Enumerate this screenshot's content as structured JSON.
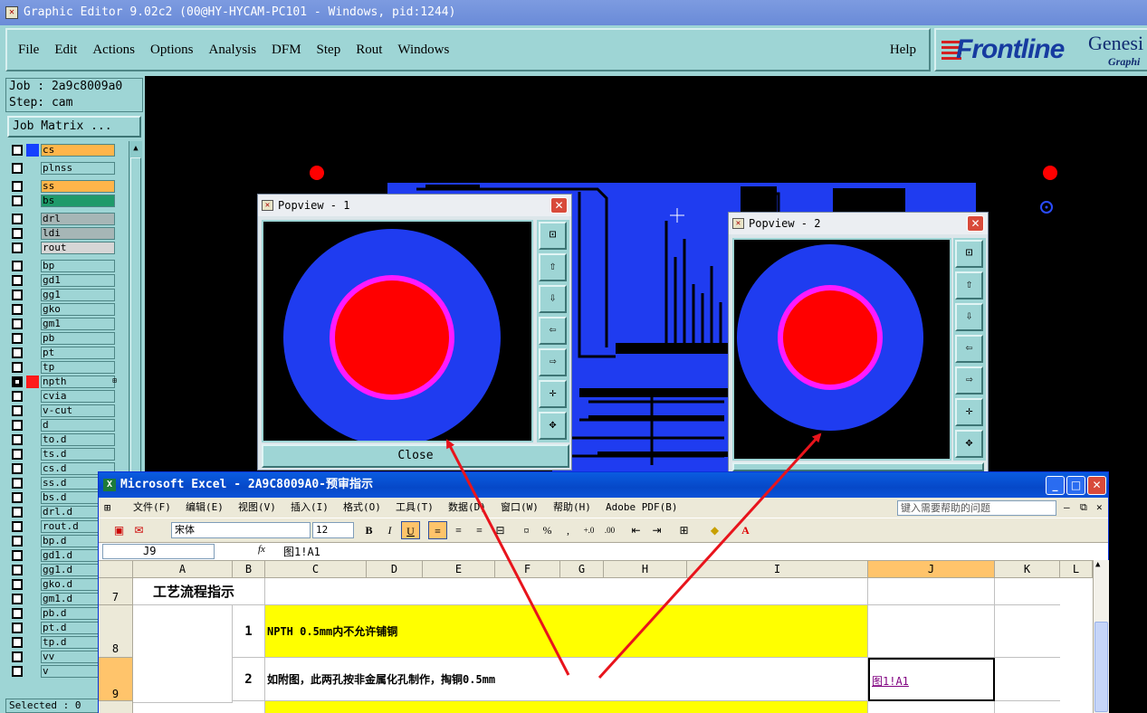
{
  "titlebar": {
    "title": "Graphic Editor 9.02c2 (00@HY-HYCAM-PC101 - Windows, pid:1244)"
  },
  "menu": {
    "items": [
      "File",
      "Edit",
      "Actions",
      "Options",
      "Analysis",
      "DFM",
      "Step",
      "Rout",
      "Windows"
    ],
    "help": "Help"
  },
  "logo": {
    "brand": "Frontline",
    "product": "Genesi",
    "sub": "Graphi"
  },
  "left": {
    "job": "Job : 2a9c8009a0",
    "step": "Step: cam",
    "job_matrix": "Job Matrix ...",
    "selected": "Selected : 0",
    "layers": [
      {
        "name": "cs",
        "color": "#1540ff",
        "bg": "#ffb54a",
        "on": false
      },
      {
        "name": "plnss",
        "color": "",
        "bg": "",
        "on": false
      },
      {
        "name": "ss",
        "color": "",
        "bg": "#ffb54a",
        "on": false
      },
      {
        "name": "bs",
        "color": "",
        "bg": "#1f9a6a",
        "on": false
      },
      {
        "name": "drl",
        "color": "",
        "bg": "#a6b6b6",
        "on": false
      },
      {
        "name": "ldi",
        "color": "",
        "bg": "#a6b6b6",
        "on": false
      },
      {
        "name": "rout",
        "color": "",
        "bg": "#d6d6d6",
        "on": false
      },
      {
        "name": "bp",
        "color": "",
        "bg": "",
        "on": false
      },
      {
        "name": "gd1",
        "color": "",
        "bg": "",
        "on": false
      },
      {
        "name": "gg1",
        "color": "",
        "bg": "",
        "on": false
      },
      {
        "name": "gko",
        "color": "",
        "bg": "",
        "on": false
      },
      {
        "name": "gm1",
        "color": "",
        "bg": "",
        "on": false
      },
      {
        "name": "pb",
        "color": "",
        "bg": "",
        "on": false
      },
      {
        "name": "pt",
        "color": "",
        "bg": "",
        "on": false
      },
      {
        "name": "tp",
        "color": "",
        "bg": "",
        "on": false
      },
      {
        "name": "npth",
        "color": "#ff1a1a",
        "bg": "",
        "on": true
      },
      {
        "name": "cvia",
        "color": "",
        "bg": "",
        "on": false
      },
      {
        "name": "v-cut",
        "color": "",
        "bg": "",
        "on": false
      },
      {
        "name": "d",
        "color": "",
        "bg": "",
        "on": false
      },
      {
        "name": "to.d",
        "color": "",
        "bg": "",
        "on": false
      },
      {
        "name": "ts.d",
        "color": "",
        "bg": "",
        "on": false
      },
      {
        "name": "cs.d",
        "color": "",
        "bg": "",
        "on": false
      },
      {
        "name": "ss.d",
        "color": "",
        "bg": "",
        "on": false
      },
      {
        "name": "bs.d",
        "color": "",
        "bg": "",
        "on": false
      },
      {
        "name": "drl.d",
        "color": "",
        "bg": "",
        "on": false
      },
      {
        "name": "rout.d",
        "color": "",
        "bg": "",
        "on": false
      },
      {
        "name": "bp.d",
        "color": "",
        "bg": "",
        "on": false
      },
      {
        "name": "gd1.d",
        "color": "",
        "bg": "",
        "on": false
      },
      {
        "name": "gg1.d",
        "color": "",
        "bg": "",
        "on": false
      },
      {
        "name": "gko.d",
        "color": "",
        "bg": "",
        "on": false
      },
      {
        "name": "gm1.d",
        "color": "",
        "bg": "",
        "on": false
      },
      {
        "name": "pb.d",
        "color": "",
        "bg": "",
        "on": false
      },
      {
        "name": "pt.d",
        "color": "",
        "bg": "",
        "on": false
      },
      {
        "name": "tp.d",
        "color": "",
        "bg": "",
        "on": false
      },
      {
        "name": "vv",
        "color": "",
        "bg": "",
        "on": false
      },
      {
        "name": "v",
        "color": "",
        "bg": "",
        "on": false
      }
    ]
  },
  "popview1": {
    "title": "Popview - 1",
    "close_label": "Close"
  },
  "popview2": {
    "title": "Popview - 2"
  },
  "colors": {
    "copper": "#1f3cf0",
    "mask": "#ff1aff",
    "drill": "#ff0000",
    "panel": "#9ed5d5",
    "arrow": "#e8141c"
  },
  "excel": {
    "title": "Microsoft Excel - 2A9C8009A0-预审指示",
    "menu": [
      "文件(F)",
      "编辑(E)",
      "视图(V)",
      "插入(I)",
      "格式(O)",
      "工具(T)",
      "数据(D)",
      "窗口(W)",
      "帮助(H)",
      "Adobe PDF(B)"
    ],
    "help_placeholder": "键入需要帮助的问题",
    "font_name": "宋体",
    "font_size": "12",
    "name_box": "J9",
    "fx": "fx",
    "formula": "图1!A1",
    "columns": [
      "A",
      "B",
      "C",
      "D",
      "E",
      "F",
      "G",
      "H",
      "I",
      "J",
      "K",
      "L"
    ],
    "rows": [
      {
        "num": "7",
        "a": "工艺流程指示",
        "b": "",
        "text": "",
        "j": ""
      },
      {
        "num": "8",
        "a": "",
        "b": "1",
        "text": "NPTH 0.5mm内不允许铺铜",
        "j": ""
      },
      {
        "num": "9",
        "a": "",
        "b": "2",
        "text": "如附图，此两孔按非金属化孔制作，掏铜0.5mm",
        "j": "图1!A1"
      }
    ]
  }
}
